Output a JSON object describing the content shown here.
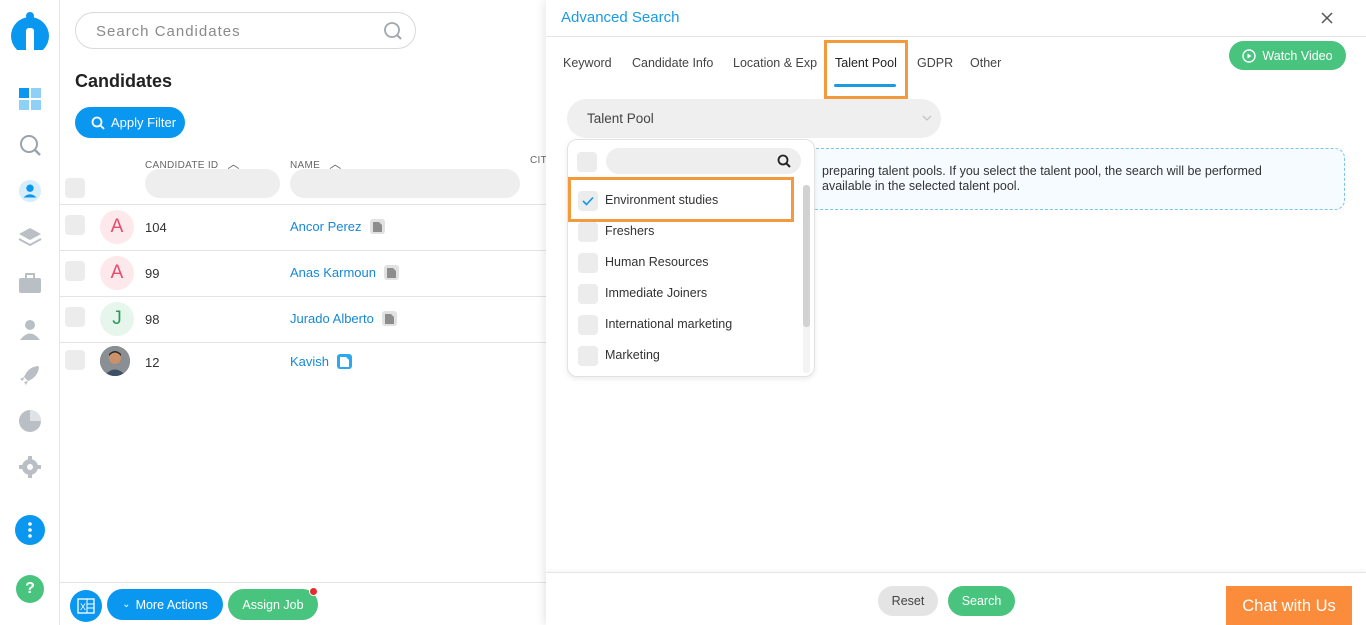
{
  "colors": {
    "accent": "#0a97ef",
    "green": "#49c47f",
    "highlight": "#f29a3c",
    "chat": "#fa8c3c"
  },
  "sidebar": {
    "icons": [
      "logo-icon",
      "dashboard-icon",
      "search-icon",
      "candidates-icon",
      "layers-icon",
      "briefcase-icon",
      "contacts-icon",
      "rocket-icon",
      "reports-icon",
      "settings-icon",
      "more-icon",
      "help-icon"
    ]
  },
  "candidates": {
    "search_placeholder": "Search Candidates",
    "title": "Candidates",
    "apply_filter": "Apply Filter",
    "columns": {
      "id": "CANDIDATE ID",
      "name": "NAME",
      "city": "CIT"
    },
    "rows": [
      {
        "initial": "A",
        "id": "104",
        "name": "Ancor Perez"
      },
      {
        "initial": "A",
        "id": "99",
        "name": "Anas Karmoun"
      },
      {
        "initial": "J",
        "id": "98",
        "name": "Jurado Alberto"
      },
      {
        "initial": "",
        "id": "12",
        "name": "Kavish"
      }
    ],
    "more_actions": "More Actions",
    "assign_job": "Assign Job"
  },
  "advanced_search": {
    "title": "Advanced Search",
    "watch_video": "Watch Video",
    "tabs": [
      "Keyword",
      "Candidate Info",
      "Location & Exp",
      "Talent Pool",
      "GDPR",
      "Other"
    ],
    "active_tab": "Talent Pool",
    "select_label": "Talent Pool",
    "info_line1": "preparing talent pools. If you select the talent pool, the search will be performed",
    "info_line2": "available in the selected talent pool.",
    "options": [
      {
        "label": "Environment studies",
        "checked": true
      },
      {
        "label": "Freshers",
        "checked": false
      },
      {
        "label": "Human Resources",
        "checked": false
      },
      {
        "label": "Immediate Joiners",
        "checked": false
      },
      {
        "label": "International marketing",
        "checked": false
      },
      {
        "label": "Marketing",
        "checked": false
      }
    ],
    "reset": "Reset",
    "search": "Search",
    "chat": "Chat with Us"
  }
}
